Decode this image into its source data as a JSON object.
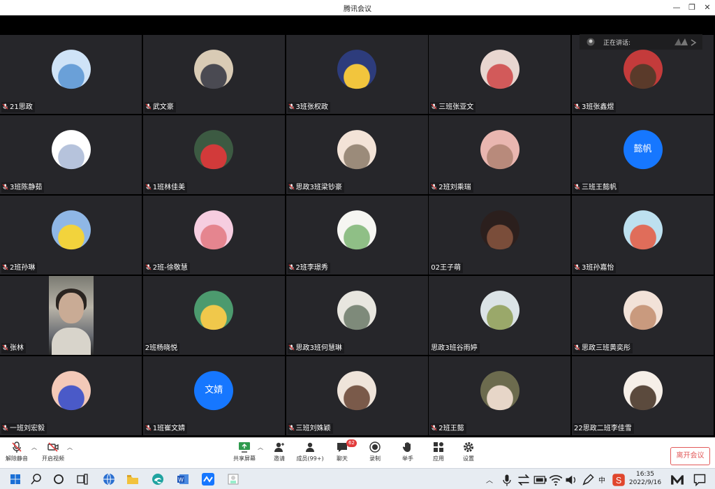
{
  "window": {
    "title": "腾讯会议",
    "minimize": "—",
    "restore": "❐",
    "close": "✕"
  },
  "speaking": {
    "label": "正在讲话:"
  },
  "participants": [
    {
      "name": "21思政",
      "avatar_colors": [
        "#cfe3f7",
        "#6aa0d8"
      ]
    },
    {
      "name": "武文豪",
      "avatar_colors": [
        "#d9cbb5",
        "#4a4a52"
      ]
    },
    {
      "name": "3班张权政",
      "avatar_colors": [
        "#2d3c7c",
        "#f2c53d"
      ]
    },
    {
      "name": "三班张亚文",
      "avatar_colors": [
        "#e8d6d0",
        "#d25a5a"
      ]
    },
    {
      "name": "3班张鑫煜",
      "avatar_colors": [
        "#c43b3b",
        "#5a3a2a"
      ]
    },
    {
      "name": "3班陈静茹",
      "avatar_colors": [
        "#ffffff",
        "#b6c3dc"
      ]
    },
    {
      "name": "1班林佳美",
      "avatar_colors": [
        "#3c5a42",
        "#d23a3a"
      ]
    },
    {
      "name": "思政3班梁钞豪",
      "avatar_colors": [
        "#f3e3d7",
        "#9b8b7a"
      ]
    },
    {
      "name": "2班刘乘瑞",
      "avatar_colors": [
        "#e9b6b0",
        "#b88a7b"
      ]
    },
    {
      "name": "三班王懿帆",
      "avatar_text": "懿帆"
    },
    {
      "name": "2班孙琳",
      "avatar_colors": [
        "#8fb7e6",
        "#f2d33c"
      ]
    },
    {
      "name": "2班-徐敬慧",
      "avatar_colors": [
        "#f6cde0",
        "#e5858f"
      ]
    },
    {
      "name": "2班李璟秀",
      "avatar_colors": [
        "#f6f6f2",
        "#8fbf86"
      ]
    },
    {
      "name": "02王子萌",
      "avatar_colors": [
        "#2b1f1d",
        "#7a4d3a"
      ]
    },
    {
      "name": "3班孙嘉怡",
      "avatar_colors": [
        "#bde0ef",
        "#e06d5a"
      ]
    },
    {
      "name": "张林",
      "video": true
    },
    {
      "name": "2班杨晓悦",
      "avatar_colors": [
        "#4c9a6e",
        "#f0c84b"
      ]
    },
    {
      "name": "思政3班何慧琳",
      "avatar_colors": [
        "#e8e6df",
        "#7e8a7a"
      ]
    },
    {
      "name": "思政3班谷雨婷",
      "avatar_colors": [
        "#dbe3e6",
        "#9aa86a"
      ]
    },
    {
      "name": "思政三班黄奕彤",
      "avatar_colors": [
        "#f2e2d8",
        "#c99a7e"
      ]
    },
    {
      "name": "一班刘宏毅",
      "avatar_colors": [
        "#f3c9b8",
        "#4a5ac8"
      ]
    },
    {
      "name": "1班崔文婧",
      "avatar_text": "文婧"
    },
    {
      "name": "三班刘姝颖",
      "avatar_colors": [
        "#efe4da",
        "#7a5a4a"
      ]
    },
    {
      "name": "2班王懿",
      "avatar_colors": [
        "#6c6b4e",
        "#e7d6c8"
      ]
    },
    {
      "name": "22思政二班李佳雪",
      "avatar_colors": [
        "#f6efe8",
        "#5b4a3d"
      ]
    }
  ],
  "toolbar": {
    "unmute": "解除静音",
    "start_video": "开启视频",
    "share_screen": "共享屏幕",
    "invite": "邀请",
    "members": "成员(99+)",
    "chat": "聊天",
    "chat_badge": "62",
    "record": "录制",
    "raise_hand": "举手",
    "apps": "应用",
    "settings": "设置",
    "leave": "离开会议"
  },
  "taskbar": {
    "time": "16:35",
    "date": "2022/9/16",
    "ime": "中"
  },
  "colors": {
    "tile_bg": "#26262a",
    "accent_blue": "#1677ff",
    "leave_red": "#e25a5a"
  }
}
